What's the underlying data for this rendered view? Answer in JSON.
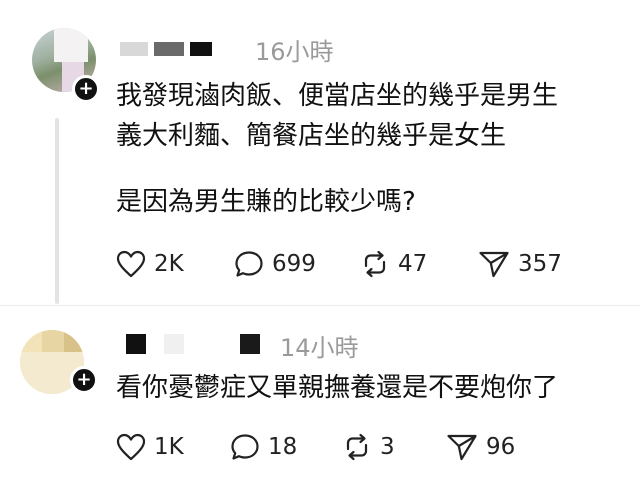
{
  "posts": [
    {
      "time": "16小時",
      "lines": [
        "我發現滷肉飯、便當店坐的幾乎是男生",
        "義大利麵、簡餐店坐的幾乎是女生",
        "是因為男生賺的比較少嗎?"
      ],
      "stats": {
        "likes": "2K",
        "replies": "699",
        "reposts": "47",
        "shares": "357"
      }
    },
    {
      "time": "14小時",
      "lines": [
        "看你憂鬱症又單親撫養還是不要炮你了"
      ],
      "stats": {
        "likes": "1K",
        "replies": "18",
        "reposts": "3",
        "shares": "96"
      }
    }
  ],
  "icons": {
    "like": "heart-icon",
    "reply": "comment-bubble-icon",
    "repost": "repost-icon",
    "share": "send-icon",
    "follow": "plus-icon"
  },
  "follow_symbol": "+"
}
